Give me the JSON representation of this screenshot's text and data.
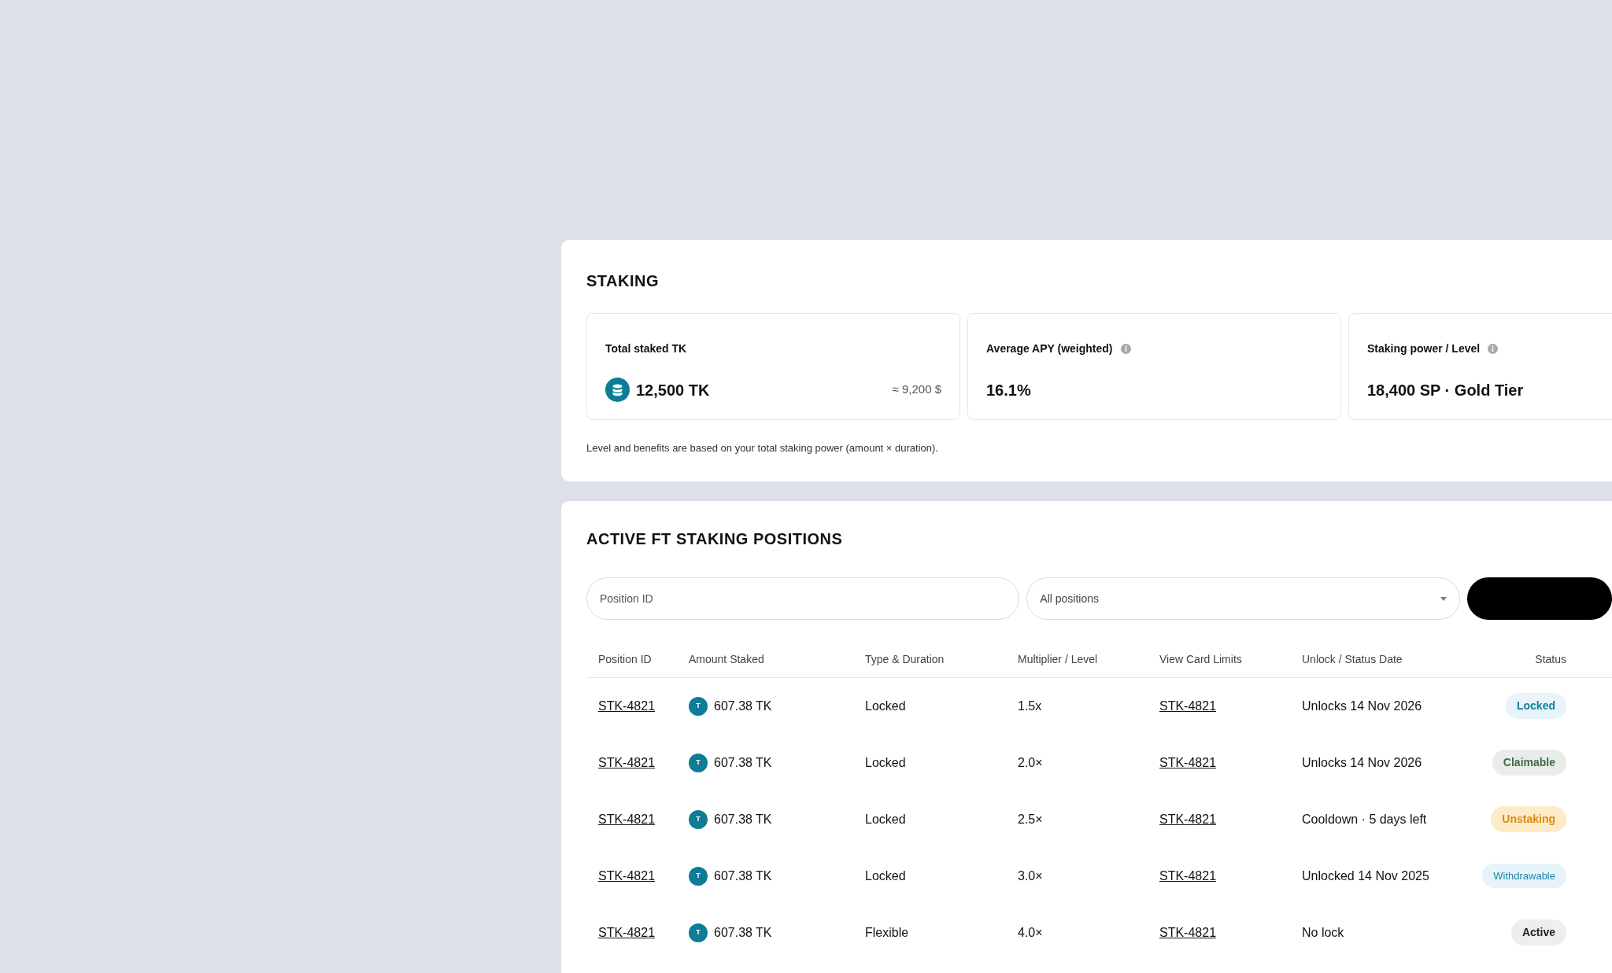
{
  "staking": {
    "title": "STAKING",
    "stats": [
      {
        "label": "Total staked TK",
        "kind": "coin",
        "value": "12,500 TK",
        "secondary": "≈ 9,200 $",
        "info": false
      },
      {
        "label": "Average APY (weighted)",
        "kind": "plain",
        "value": "16.1%",
        "info": true
      },
      {
        "label": "Staking power / Level",
        "kind": "plain",
        "value": "18,400 SP · Gold Tier",
        "info": true
      }
    ],
    "note": "Level and benefits are based on your total staking power (amount × duration)."
  },
  "positions": {
    "title": "ACTIVE FT STAKING POSITIONS",
    "search": {
      "placeholder": "Position ID"
    },
    "filter": {
      "value": "All positions"
    },
    "columns": [
      "Position ID",
      "Amount Staked",
      "Type & Duration",
      "Multiplier / Level",
      "View Card Limits",
      "Unlock / Status Date",
      "Status"
    ],
    "rows": [
      {
        "id": "STK-4821",
        "token": "T",
        "amount": "607.38 TK",
        "type": "Locked",
        "multiplier": "1.5x",
        "limits": "STK-4821",
        "date": "Unlocks 14 Nov 2026",
        "status": {
          "label": "Locked",
          "kind": "locked"
        }
      },
      {
        "id": "STK-4821",
        "token": "T",
        "amount": "607.38 TK",
        "type": "Locked",
        "multiplier": "2.0×",
        "limits": "STK-4821",
        "date": "Unlocks 14 Nov 2026",
        "status": {
          "label": "Claimable",
          "kind": "claimable"
        }
      },
      {
        "id": "STK-4821",
        "token": "T",
        "amount": "607.38 TK",
        "type": "Locked",
        "multiplier": "2.5×",
        "limits": "STK-4821",
        "date": "Cooldown · 5 days left",
        "status": {
          "label": "Unstaking",
          "kind": "unstaking"
        }
      },
      {
        "id": "STK-4821",
        "token": "T",
        "amount": "607.38 TK",
        "type": "Locked",
        "multiplier": "3.0×",
        "limits": "STK-4821",
        "date": "Unlocked 14 Nov 2025",
        "status": {
          "label": "Withdrawable",
          "kind": "withdrawable"
        }
      },
      {
        "id": "STK-4821",
        "token": "T",
        "amount": "607.38 TK",
        "type": "Flexible",
        "multiplier": "4.0×",
        "limits": "STK-4821",
        "date": "No lock",
        "status": {
          "label": "Active",
          "kind": "active"
        }
      }
    ]
  }
}
